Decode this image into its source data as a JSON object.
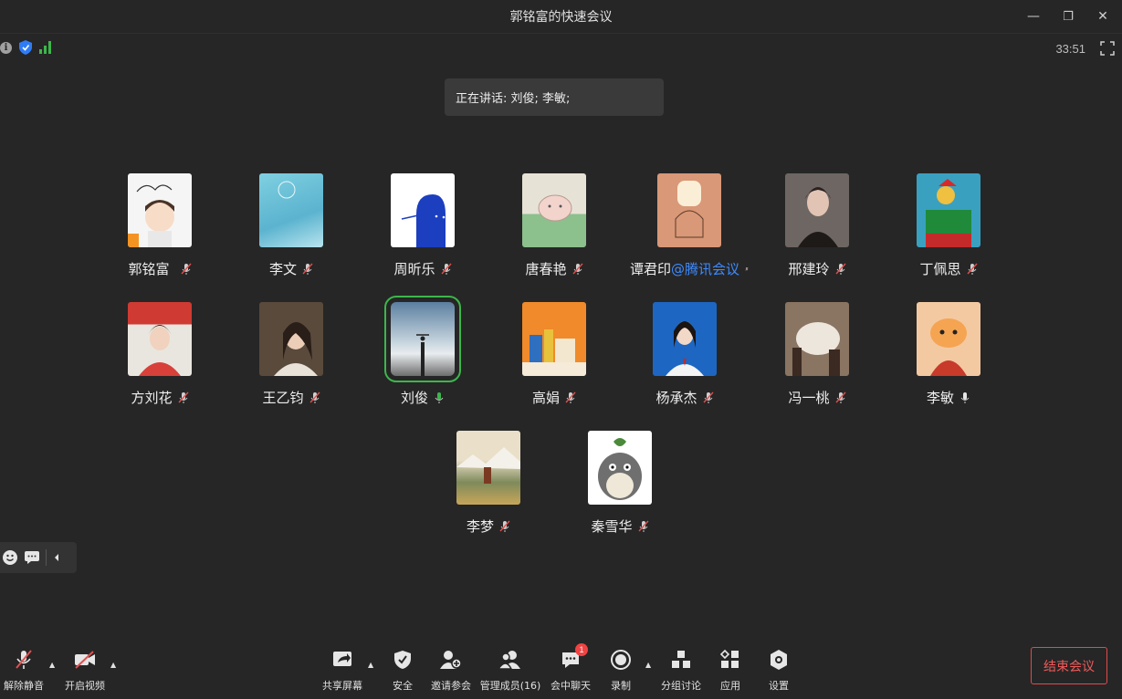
{
  "window": {
    "title": "郭铭富的快速会议",
    "minimize": "—",
    "maximize": "❐",
    "close": "✕"
  },
  "status": {
    "info": "i",
    "timer": "33:51"
  },
  "speaking": {
    "text": "正在讲话: 刘俊; 李敏;"
  },
  "participants": [
    {
      "name": "郭铭富",
      "suffix": "",
      "mic": "muted"
    },
    {
      "name": "李文",
      "suffix": "",
      "mic": "muted"
    },
    {
      "name": "周昕乐",
      "suffix": "",
      "mic": "muted"
    },
    {
      "name": "唐春艳",
      "suffix": "",
      "mic": "muted"
    },
    {
      "name": "谭君印",
      "suffix": "@腾讯会议",
      "mic": "muted"
    },
    {
      "name": "邢建玲",
      "suffix": "",
      "mic": "muted"
    },
    {
      "name": "丁佩思",
      "suffix": "",
      "mic": "muted"
    },
    {
      "name": "方刘花",
      "suffix": "",
      "mic": "muted"
    },
    {
      "name": "王乙钧",
      "suffix": "",
      "mic": "muted"
    },
    {
      "name": "刘俊",
      "suffix": "",
      "mic": "speaking"
    },
    {
      "name": "高娟",
      "suffix": "",
      "mic": "muted"
    },
    {
      "name": "杨承杰",
      "suffix": "",
      "mic": "muted"
    },
    {
      "name": "冯一桃",
      "suffix": "",
      "mic": "muted"
    },
    {
      "name": "李敏",
      "suffix": "",
      "mic": "on"
    },
    {
      "name": "李梦",
      "suffix": "",
      "mic": "muted"
    },
    {
      "name": "秦雪华",
      "suffix": "",
      "mic": "muted"
    }
  ],
  "toolbar": {
    "unmute": "解除静音",
    "video": "开启视频",
    "share": "共享屏幕",
    "security": "安全",
    "invite": "邀请参会",
    "members": "管理成员(16)",
    "chat": "会中聊天",
    "chat_badge": "1",
    "record": "录制",
    "breakout": "分组讨论",
    "apps": "应用",
    "settings": "设置",
    "end": "结束会议"
  },
  "colors": {
    "background": "#262626",
    "active_border": "#3cb64b",
    "end_red": "#e24a4a",
    "link_blue": "#3e8bff",
    "mic_muted": "#e05050"
  }
}
